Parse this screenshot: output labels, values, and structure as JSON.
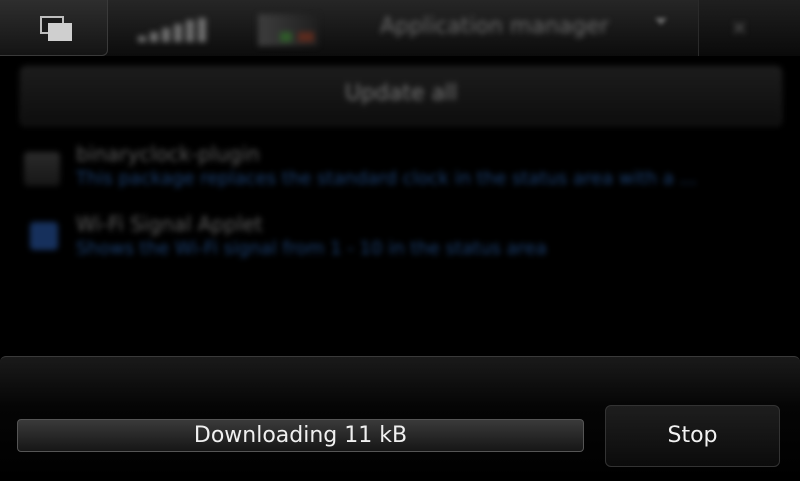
{
  "statusbar": {
    "title": "Application manager",
    "icons": [
      "task-switcher-icon",
      "signal-icon",
      "battery-icon",
      "menu-arrow-icon",
      "close-icon"
    ]
  },
  "content": {
    "update_all_label": "Update all",
    "packages": [
      {
        "name": "binaryclock-plugin",
        "description": "This package replaces the standard clock in the status area with a ..."
      },
      {
        "name": "Wi-Fi Signal Applet",
        "description": "Shows the Wi-Fi signal from 1 - 10 in the status area"
      }
    ]
  },
  "download": {
    "status_text": "Downloading 11 kB",
    "progress_fraction": 0.0,
    "stop_label": "Stop"
  },
  "colors": {
    "background": "#000000",
    "text": "#f0f0f0",
    "link_blue": "#1b3f70"
  }
}
